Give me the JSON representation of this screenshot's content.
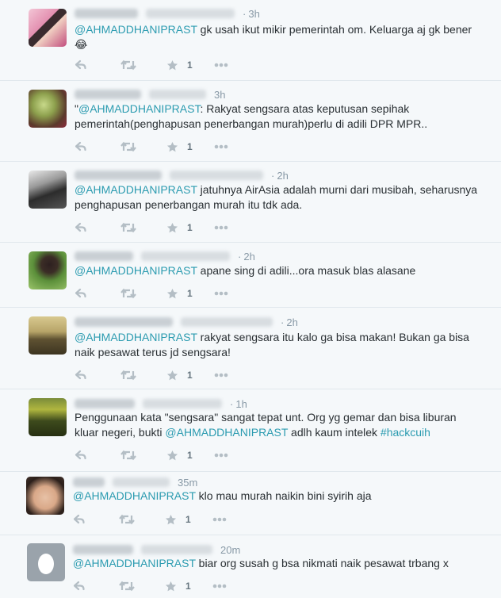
{
  "tweets": [
    {
      "time": "3h",
      "segments": [
        {
          "type": "mention",
          "text": "@AHMADDHANIPRAST"
        },
        {
          "type": "text",
          "text": "  gk usah ikut mikir pemerintah om. Keluarga aj gk bener 😂"
        }
      ],
      "favorites": "1",
      "avatar": "girl-photo-avatar"
    },
    {
      "time": "3h",
      "segments": [
        {
          "type": "text",
          "text": "\""
        },
        {
          "type": "mention",
          "text": "@AHMADDHANIPRAST"
        },
        {
          "type": "text",
          "text": ": Rakyat sengsara atas keputusan sepihak pemerintah(penghapusan penerbangan murah)perlu di adili DPR MPR.."
        }
      ],
      "favorites": "1",
      "avatar": "tree-photo-avatar"
    },
    {
      "time": "2h",
      "segments": [
        {
          "type": "mention",
          "text": "@AHMADDHANIPRAST"
        },
        {
          "type": "text",
          "text": " jatuhnya AirAsia adalah murni dari musibah, seharusnya penghapusan penerbangan murah itu tdk ada."
        }
      ],
      "favorites": "1",
      "avatar": "bw-photo-avatar"
    },
    {
      "time": "2h",
      "segments": [
        {
          "type": "mention",
          "text": "@AHMADDHANIPRAST"
        },
        {
          "type": "text",
          "text": " apane sing di adili...ora masuk blas alasane"
        }
      ],
      "favorites": "1",
      "avatar": "garden-photo-avatar"
    },
    {
      "time": "2h",
      "segments": [
        {
          "type": "mention",
          "text": "@AHMADDHANIPRAST"
        },
        {
          "type": "text",
          "text": " rakyat sengsara itu kalo ga bisa makan! Bukan ga bisa naik pesawat terus jd sengsara!"
        }
      ],
      "favorites": "1",
      "avatar": "bicycle-photo-avatar"
    },
    {
      "time": "1h",
      "segments": [
        {
          "type": "text",
          "text": "Penggunaan kata \"sengsara\" sangat tepat unt. Org yg gemar dan bisa liburan kluar negeri, bukti "
        },
        {
          "type": "mention",
          "text": "@AHMADDHANIPRAST"
        },
        {
          "type": "text",
          "text": " adlh kaum intelek "
        },
        {
          "type": "hashtag",
          "text": "#hackcuih"
        }
      ],
      "favorites": "1",
      "avatar": "field-photo-avatar"
    },
    {
      "time": "35m",
      "segments": [
        {
          "type": "mention",
          "text": "@AHMADDHANIPRAST"
        },
        {
          "type": "text",
          "text": " klo mau murah naikin bini syirih aja"
        }
      ],
      "favorites": "1",
      "avatar": "baby-photo-avatar"
    },
    {
      "time": "20m",
      "segments": [
        {
          "type": "mention",
          "text": "@AHMADDHANIPRAST"
        },
        {
          "type": "text",
          "text": " biar org susah g bsa nikmati naik pesawat trbang x"
        }
      ],
      "favorites": "1",
      "avatar": "default-egg-avatar"
    }
  ],
  "colors": {
    "link": "#2b9bb0",
    "icon": "#b4bec5",
    "background": "#f5f8fa",
    "divider": "#e1e8ed"
  },
  "icons": [
    "reply-icon",
    "retweet-icon",
    "favorite-star-icon",
    "more-icon"
  ]
}
